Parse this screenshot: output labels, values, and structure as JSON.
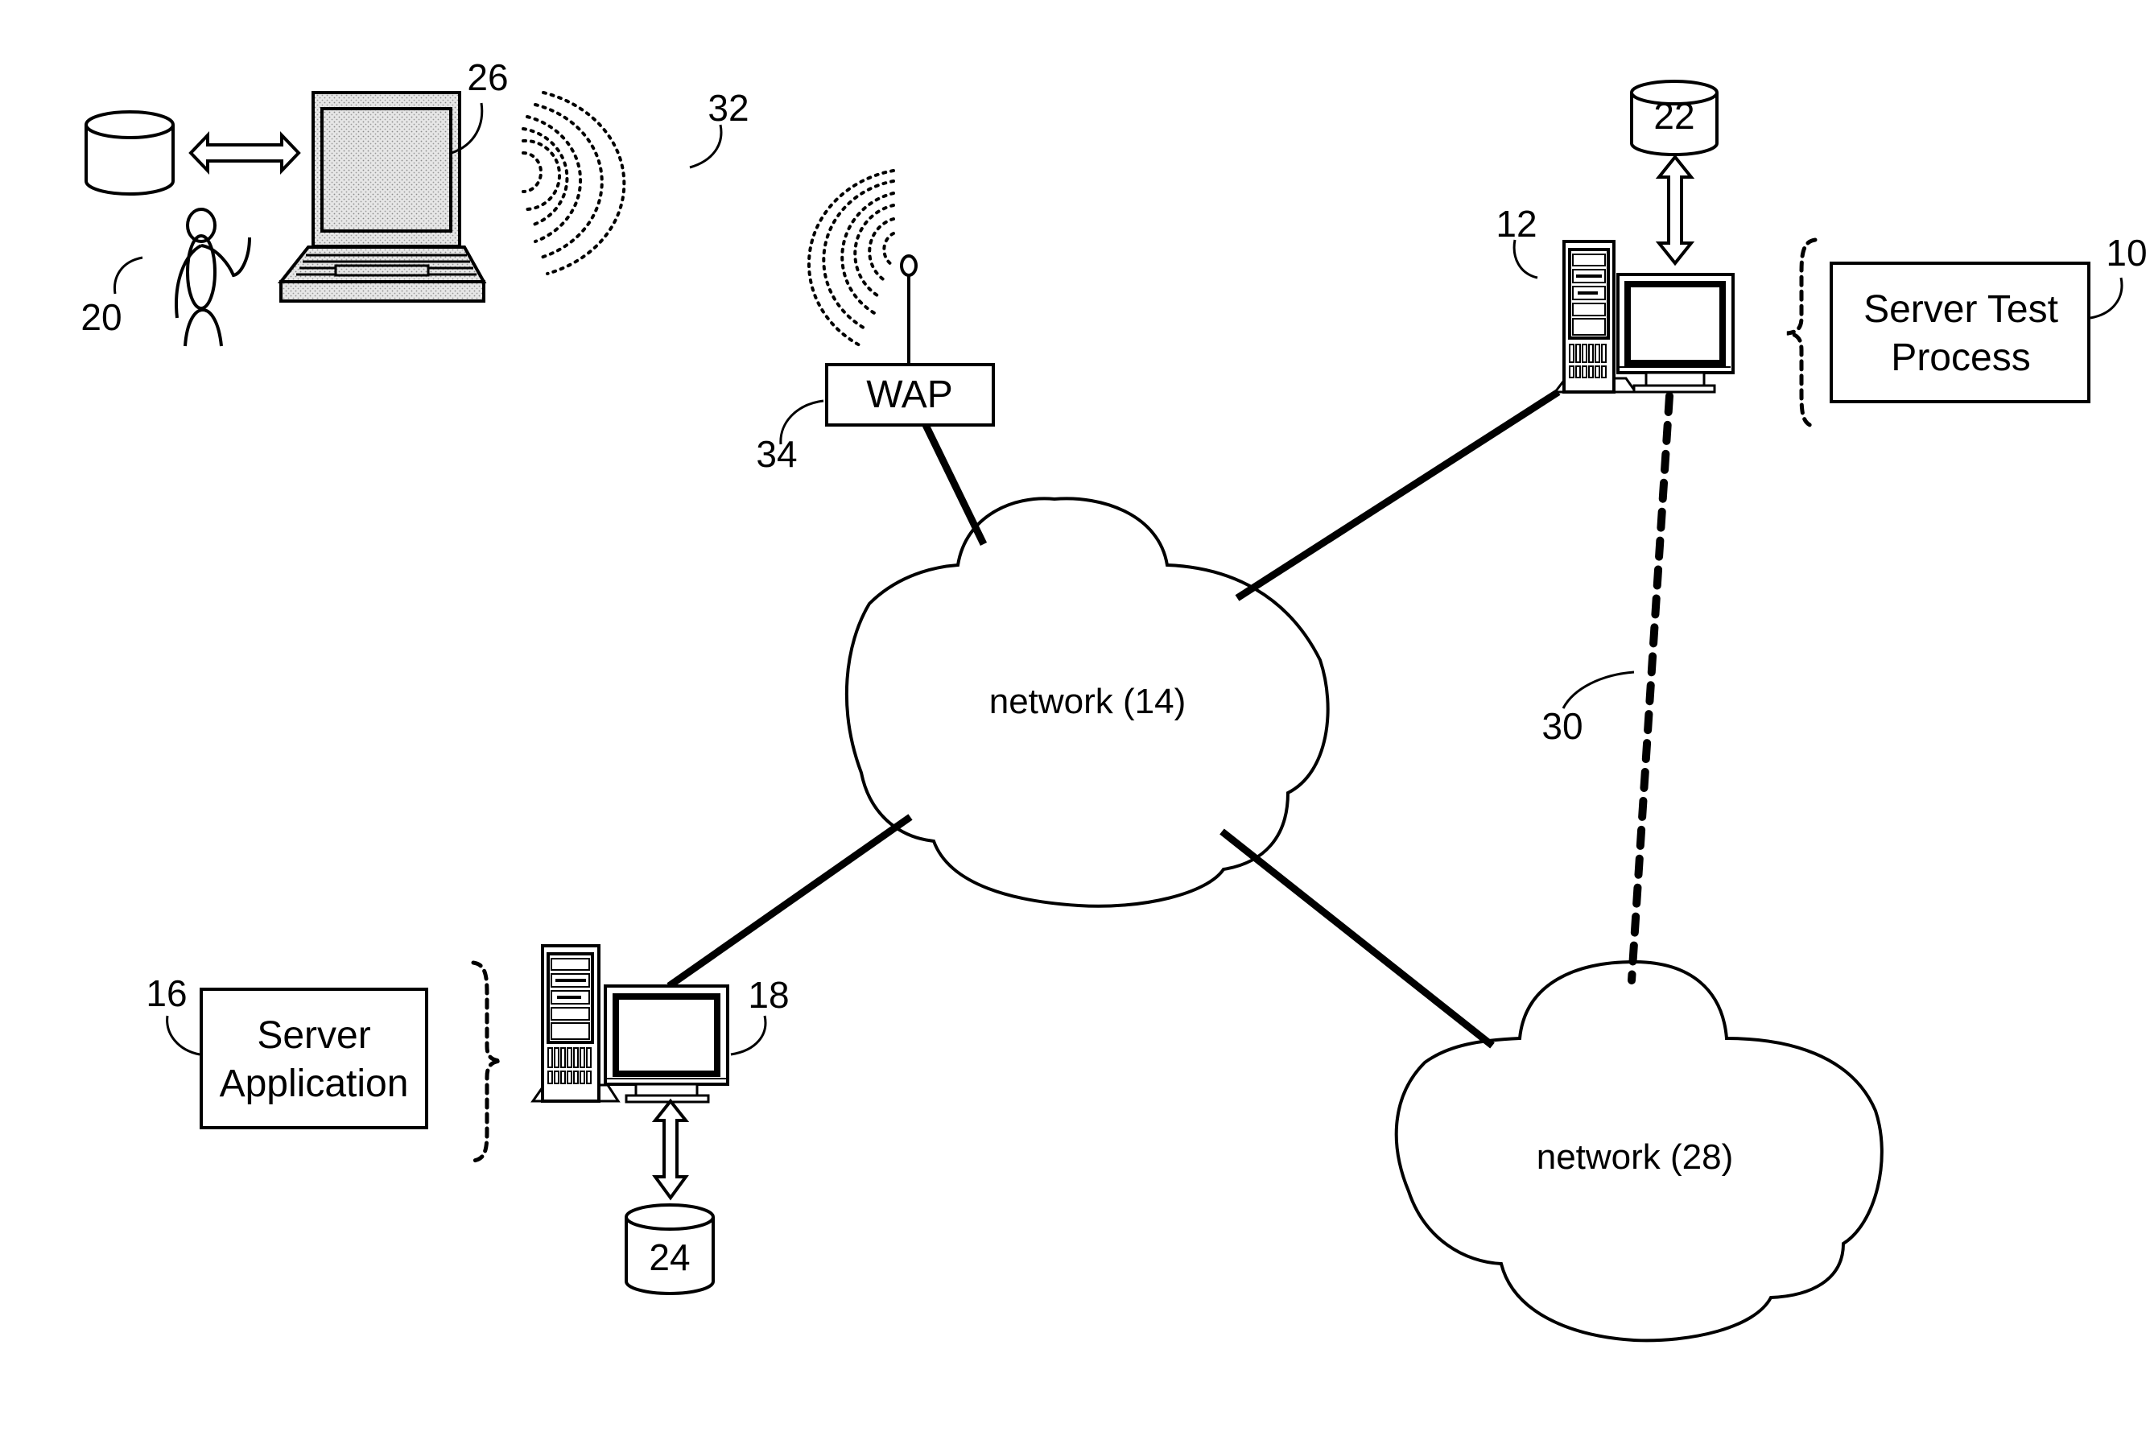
{
  "diagram": {
    "type": "network-architecture",
    "nodes": {
      "server_test_process": {
        "ref": "10",
        "label_line1": "Server Test",
        "label_line2": "Process"
      },
      "server_12": {
        "ref": "12"
      },
      "network_14": {
        "label": "network (14)"
      },
      "server_application": {
        "ref": "16",
        "label_line1": "Server",
        "label_line2": "Application"
      },
      "server_18": {
        "ref": "18"
      },
      "user": {
        "ref": "20"
      },
      "database_22": {
        "ref": "22"
      },
      "database_24": {
        "ref": "24"
      },
      "laptop": {
        "ref": "26"
      },
      "network_28": {
        "label": "network (28)"
      },
      "link_30": {
        "ref": "30"
      },
      "wireless_signal": {
        "ref": "32"
      },
      "wap": {
        "ref": "34",
        "label": "WAP"
      }
    },
    "edges": [
      {
        "from": "wap",
        "to": "network_14",
        "style": "solid"
      },
      {
        "from": "server_12",
        "to": "network_14",
        "style": "solid"
      },
      {
        "from": "server_18",
        "to": "network_14",
        "style": "solid"
      },
      {
        "from": "network_14",
        "to": "network_28",
        "style": "solid"
      },
      {
        "from": "server_12",
        "to": "network_28",
        "style": "dashed",
        "ref": "30"
      },
      {
        "from": "server_12",
        "to": "database_22",
        "style": "double-arrow"
      },
      {
        "from": "server_18",
        "to": "database_24",
        "style": "double-arrow"
      },
      {
        "from": "laptop",
        "to": "local_database",
        "style": "double-arrow"
      },
      {
        "from": "laptop",
        "to": "wap",
        "style": "wireless"
      }
    ]
  }
}
